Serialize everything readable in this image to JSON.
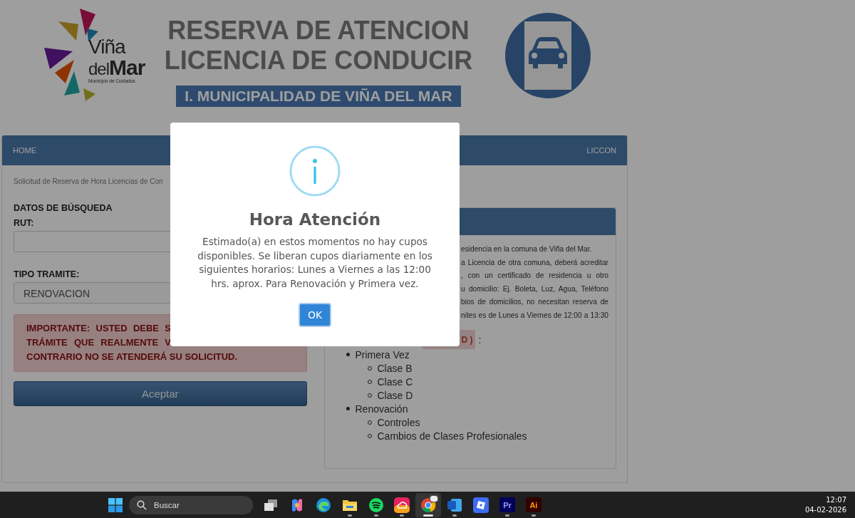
{
  "header": {
    "logo": {
      "word1": "Viña",
      "word2": "del",
      "word3": "Mar",
      "tagline": "Municipio de Cuidados"
    },
    "title_lines": [
      "RESERVA DE ATENCION",
      "LICENCIA DE CONDUCIR"
    ],
    "banner": "I. MUNICIPALIDAD DE VIÑA DEL MAR"
  },
  "navbar": {
    "left": "HOME",
    "right": "LICCON"
  },
  "breadcrumb": "Solicitud de Reserva de Hora Licencias de Con",
  "form": {
    "section_title": "DATOS DE BÚSQUEDA",
    "fields": [
      {
        "kind": "input",
        "label": "RUT:"
      },
      {
        "kind": "select",
        "label": "TIPO TRAMITE:",
        "value": "RENOVACION"
      }
    ],
    "alert_lines": [
      "IMPORTANTE: USTED DEBE S",
      "TRÁMITE QUE REALMENTE V",
      "CONTRARIO NO SE ATENDERÁ SU SOLICITUD."
    ],
    "submit": "Aceptar"
  },
  "info_panel": {
    "lines": [
      "esidencia en la comuna de Viña del Mar.",
      "a Licencia de otra comuna, deberá acreditar",
      ", con un certificado de residencia u otro",
      "u domicilio: Ej. Boleta, Luz, Agua, Teléfono",
      "bios de domicilios, no necesitan reserva de",
      "nites es de Lunes a Viernes de 12:00 a 13:30"
    ],
    "badge": "D )",
    "badge_suffix": ":",
    "list": [
      {
        "label": "Primera Vez",
        "children": [
          {
            "label": "Clase B"
          },
          {
            "label": "Clase C"
          },
          {
            "label": "Clase D"
          }
        ]
      },
      {
        "label": "Renovación",
        "children": [
          {
            "label": "Controles"
          },
          {
            "label": "Cambios de Clases Profesionales"
          }
        ]
      }
    ]
  },
  "dialog": {
    "title": "Hora Atención",
    "message": "Estimado(a) en estos momentos no hay cupos disponibles. Se liberan cupos diariamente en los siguientes horarios: Lunes a Viernes a las 12:00 hrs. aprox. Para Renovación y Primera vez.",
    "button": "OK"
  },
  "taskbar": {
    "search_placeholder": "Buscar",
    "apps": [
      {
        "kind": "task-view",
        "running": false,
        "active": false
      },
      {
        "kind": "copilot",
        "running": false,
        "active": false
      },
      {
        "kind": "edge",
        "running": false,
        "active": false
      },
      {
        "kind": "files",
        "running": true,
        "active": false
      },
      {
        "kind": "spotify",
        "running": true,
        "active": false
      },
      {
        "kind": "creative-cloud",
        "running": true,
        "active": false
      },
      {
        "kind": "chrome",
        "running": true,
        "active": true
      },
      {
        "kind": "word",
        "running": true,
        "active": false
      },
      {
        "kind": "roblox",
        "running": false,
        "active": false
      },
      {
        "kind": "premiere",
        "label": "Pr",
        "running": true,
        "active": false
      },
      {
        "kind": "illustrator",
        "label": "Ai",
        "running": true,
        "active": false
      }
    ],
    "time": "12:07",
    "date": "04-02-2026"
  }
}
